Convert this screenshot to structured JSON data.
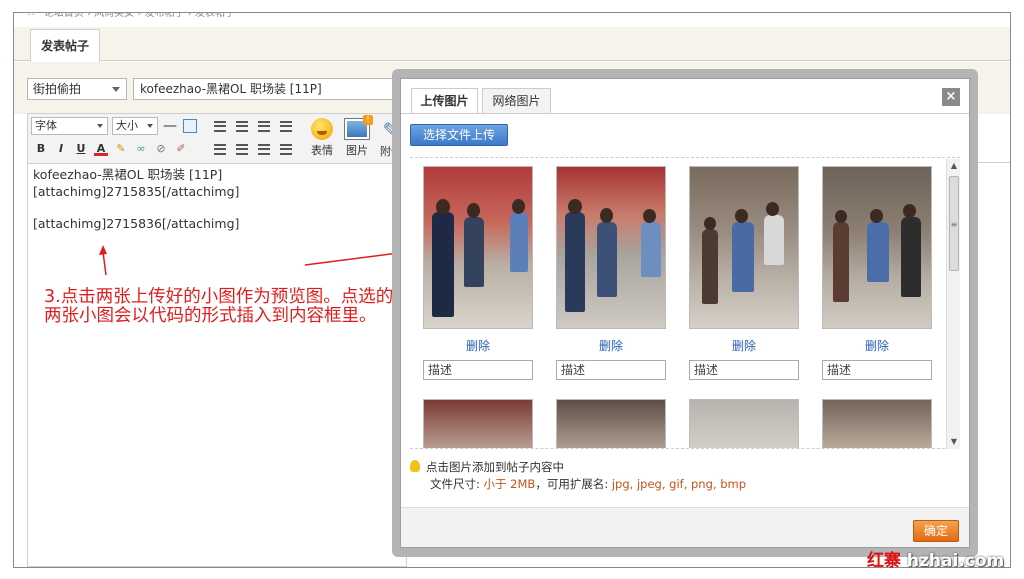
{
  "breadcrumb": "∴ · 论坛首页 › 风尚美女 › 发布帖子 › 发表帖子",
  "tab_post": "发表帖子",
  "category_select": "街拍偷拍",
  "title_value": "kofeezhao-黑裙OL 职场装 [11P]",
  "toolbar": {
    "font_select": "字体",
    "size_select": "大小",
    "smiley_label": "表情",
    "image_label": "图片",
    "attach_label": "附件",
    "badge": "!",
    "b": "B",
    "i": "I",
    "u": "U",
    "a": "A"
  },
  "editor": {
    "line1": "kofeezhao-黑裙OL 职场装 [11P]",
    "line2": "[attachimg]2715835[/attachimg]",
    "line3": "[attachimg]2715836[/attachimg]"
  },
  "note": "3.点击两张上传好的小图作为预览图。点选的两张小图会以代码的形式插入到内容框里。",
  "dialog": {
    "tab_upload": "上传图片",
    "tab_web": "网络图片",
    "close": "×",
    "upload_button": "选择文件上传",
    "thumbs": [
      {
        "delete": "删除",
        "desc": "描述"
      },
      {
        "delete": "删除",
        "desc": "描述"
      },
      {
        "delete": "删除",
        "desc": "描述"
      },
      {
        "delete": "删除",
        "desc": "描述"
      }
    ],
    "scroll_grip": "≡",
    "scroll_up": "▲",
    "scroll_down": "▼",
    "tip_line1": "点击图片添加到帖子内容中",
    "tip_prefix": "文件尺寸: ",
    "tip_size": "小于 2MB",
    "tip_mid": "，可用扩展名: ",
    "tip_exts": "jpg, jpeg, gif, png, bmp",
    "ok": "确定"
  },
  "watermark_red": "红寨",
  "watermark": "hzhai.com"
}
